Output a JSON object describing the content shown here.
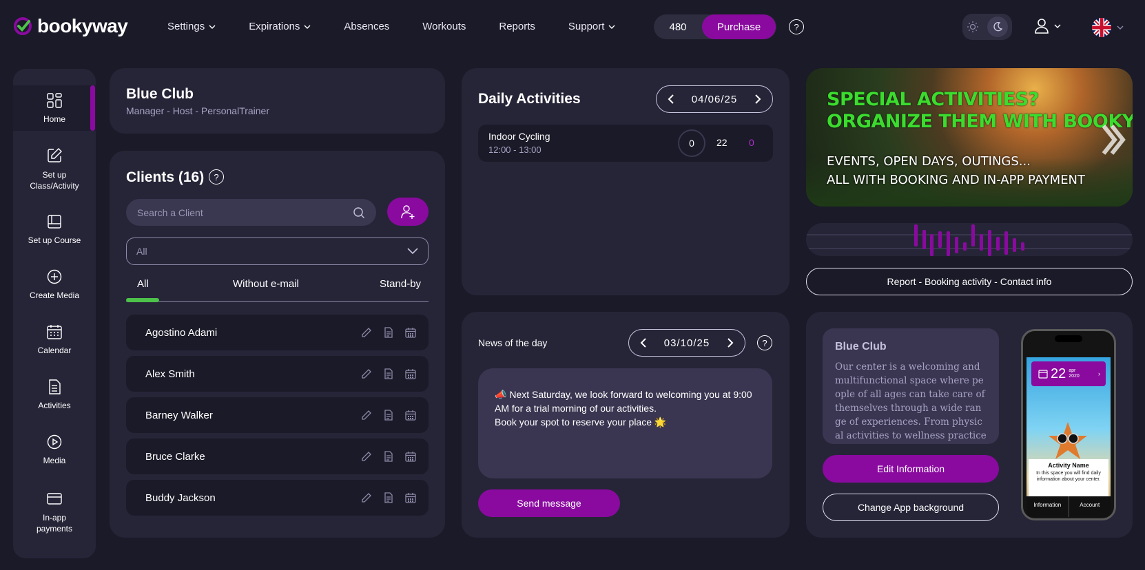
{
  "app": {
    "name": "bookyway"
  },
  "nav": [
    {
      "label": "Settings",
      "dropdown": true
    },
    {
      "label": "Expirations",
      "dropdown": true
    },
    {
      "label": "Absences",
      "dropdown": false
    },
    {
      "label": "Workouts",
      "dropdown": false
    },
    {
      "label": "Reports",
      "dropdown": false
    },
    {
      "label": "Support",
      "dropdown": true
    }
  ],
  "credits": {
    "count": "480",
    "purchase_label": "Purchase"
  },
  "colors": {
    "accent": "#8a0aa0",
    "background": "#1b1a28",
    "card": "#262538",
    "green": "#4cc24a"
  },
  "sidebar": {
    "items": [
      {
        "label": "Home",
        "icon": "grid-icon",
        "active": true
      },
      {
        "label": "Set up Class/Activity",
        "icon": "edit-square-icon"
      },
      {
        "label": "Set up Course",
        "icon": "book-icon"
      },
      {
        "label": "Create Media",
        "icon": "plus-circle-icon"
      },
      {
        "label": "Calendar",
        "icon": "calendar-icon"
      },
      {
        "label": "Activities",
        "icon": "document-icon"
      },
      {
        "label": "Media",
        "icon": "play-circle-icon"
      },
      {
        "label": "In-app payments",
        "icon": "credit-card-icon"
      }
    ]
  },
  "club": {
    "name": "Blue Club",
    "roles": "Manager - Host - PersonalTrainer"
  },
  "clients": {
    "title": "Clients (16)",
    "search_placeholder": "Search a Client",
    "filter_value": "All",
    "tabs": [
      "All",
      "Without e-mail",
      "Stand-by"
    ],
    "active_tab": 0,
    "rows": [
      "Agostino Adami",
      "Alex Smith",
      "Barney Walker",
      "Bruce Clarke",
      "Buddy Jackson"
    ]
  },
  "daily": {
    "title": "Daily Activities",
    "date": "04/06/25",
    "activities": [
      {
        "name": "Indoor Cycling",
        "time": "12:00 - 13:00",
        "booked": "0",
        "capacity": "22",
        "waiting": "0"
      }
    ]
  },
  "news": {
    "title": "News of the day",
    "date": "03/10/25",
    "message_line1": "📣 Next Saturday, we look forward to welcoming you at 9:00 AM for a trial morning of our activities.",
    "message_line2": "Book your spot to reserve your place 🌟",
    "send_label": "Send message"
  },
  "banner": {
    "line1": "SPECIAL ACTIVITIES?",
    "line2": "ORGANIZE THEM WITH BOOKYWAY",
    "line3": "EVENTS, OPEN DAYS, OUTINGS...",
    "line4": "ALL WITH BOOKING AND IN-APP PAYMENT"
  },
  "report_label": "Report - Booking activity - Contact info",
  "app_info": {
    "title": "Blue Club",
    "description": "Our center is a welcoming and multifunctional space where people of all ages can take care of themselves through a wide range of experiences. From physical activities to wellness practices, from",
    "edit_label": "Edit Information",
    "background_label": "Change App background"
  },
  "phone": {
    "day": "22",
    "month": "apr",
    "year": "2020",
    "card_title": "Activity Name",
    "card_text": "In this space you will find daily information about your center.",
    "footer_left": "Information",
    "footer_right": "Account"
  }
}
